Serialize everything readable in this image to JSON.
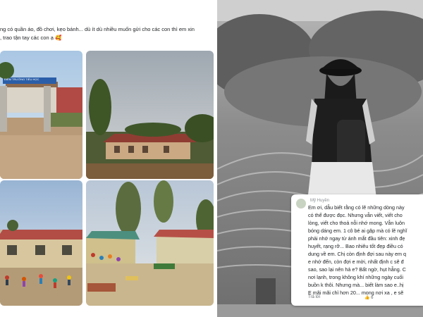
{
  "post": {
    "text_lines": [
      "ng có quần áo, đồ chơi, kẹo bánh... dù ít dù nhiều muốn gửi cho các con thì em xin",
      ", trao tận tay các con ạ 🥰"
    ],
    "school_sign": "ĐIỂM TRƯỜNG TIỂU HỌC"
  },
  "comment": {
    "author": "Mỹ Huyền",
    "lines": [
      "Em ơi, dẫu biết rằng có lẽ những dòng này",
      "có thể được đọc. Nhưng vẫn viết, viết cho",
      "lòng, viết cho thoả nỗi nhớ mong.  Vẫn luôn",
      "bóng dáng em. 1 cô bé ai gặp mà có lẽ nghĩ",
      "phải nhớ ngay từ ánh mắt đầu tiên: xinh đẹ",
      "huyết, rạng rỡ... Bao nhiêu tốt đẹp điều có",
      "dung về em. Chị còn định đợi sau này em q",
      "e nhớ đến, còn đợi e mời, nhất định c sẽ đ",
      "sao, sao lại nên hả e? Bất ngờ, hụt hẫng. C",
      "nơi lạnh, trong không khí những ngày cuối",
      "buồn k thôi. Nhưng mà... biết làm sao e..hị",
      "E mãi mãi chỉ hơn 20... mong nơi xa , e sẽ"
    ],
    "time": "Trả lời",
    "reactions": "6"
  }
}
